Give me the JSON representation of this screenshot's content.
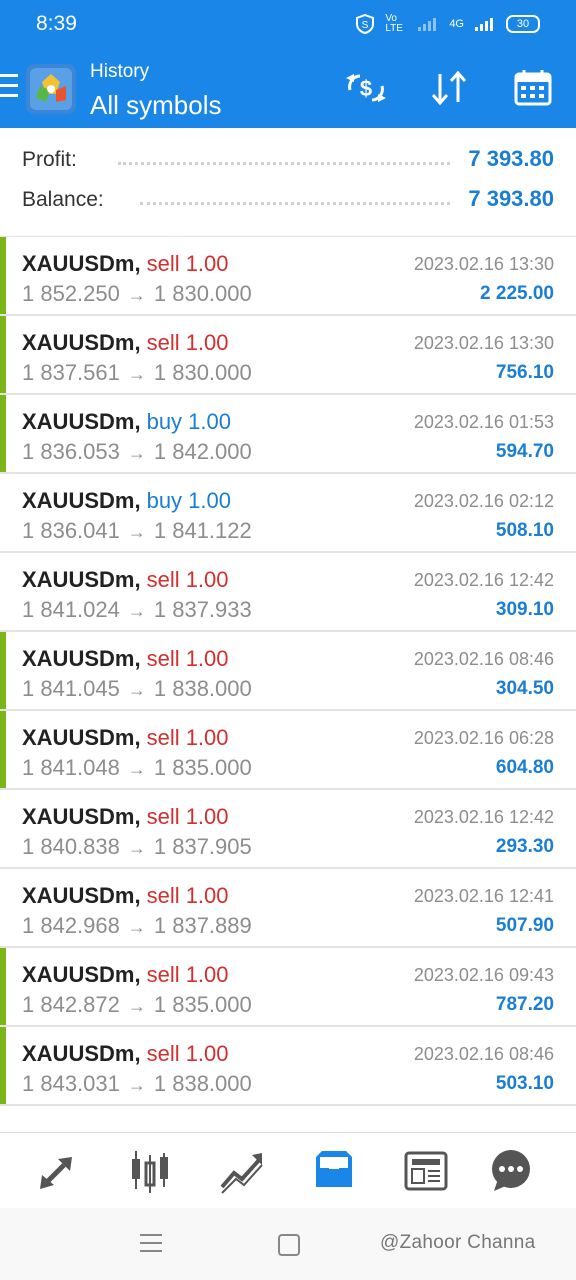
{
  "status_bar": {
    "time": "8:39",
    "network_label": "Vo LTE",
    "signal_label": "4G",
    "battery": "30"
  },
  "header": {
    "title_small": "History",
    "title_big": "All symbols",
    "icons": [
      "menu-icon",
      "app-logo",
      "deposit-icon",
      "sort-icon",
      "calendar-icon"
    ],
    "color": "#1a86e8"
  },
  "summary": {
    "profit_label": "Profit:",
    "profit_value": "7 393.80",
    "balance_label": "Balance:",
    "balance_value": "7 393.80",
    "value_color": "#1a7ed4"
  },
  "trades": [
    {
      "symbol": "XAUUSDm,",
      "side": "sell",
      "volume_label": "sell 1.00",
      "open": "1 852.250",
      "close": "1 830.000",
      "time": "2023.02.16 13:30",
      "profit": "2 225.00",
      "marker": true
    },
    {
      "symbol": "XAUUSDm,",
      "side": "sell",
      "volume_label": "sell 1.00",
      "open": "1 837.561",
      "close": "1 830.000",
      "time": "2023.02.16 13:30",
      "profit": "756.10",
      "marker": true
    },
    {
      "symbol": "XAUUSDm,",
      "side": "buy",
      "volume_label": "buy 1.00",
      "open": "1 836.053",
      "close": "1 842.000",
      "time": "2023.02.16 01:53",
      "profit": "594.70",
      "marker": true
    },
    {
      "symbol": "XAUUSDm,",
      "side": "buy",
      "volume_label": "buy 1.00",
      "open": "1 836.041",
      "close": "1 841.122",
      "time": "2023.02.16 02:12",
      "profit": "508.10",
      "marker": false
    },
    {
      "symbol": "XAUUSDm,",
      "side": "sell",
      "volume_label": "sell 1.00",
      "open": "1 841.024",
      "close": "1 837.933",
      "time": "2023.02.16 12:42",
      "profit": "309.10",
      "marker": false
    },
    {
      "symbol": "XAUUSDm,",
      "side": "sell",
      "volume_label": "sell 1.00",
      "open": "1 841.045",
      "close": "1 838.000",
      "time": "2023.02.16 08:46",
      "profit": "304.50",
      "marker": true
    },
    {
      "symbol": "XAUUSDm,",
      "side": "sell",
      "volume_label": "sell 1.00",
      "open": "1 841.048",
      "close": "1 835.000",
      "time": "2023.02.16 06:28",
      "profit": "604.80",
      "marker": true
    },
    {
      "symbol": "XAUUSDm,",
      "side": "sell",
      "volume_label": "sell 1.00",
      "open": "1 840.838",
      "close": "1 837.905",
      "time": "2023.02.16 12:42",
      "profit": "293.30",
      "marker": false
    },
    {
      "symbol": "XAUUSDm,",
      "side": "sell",
      "volume_label": "sell 1.00",
      "open": "1 842.968",
      "close": "1 837.889",
      "time": "2023.02.16 12:41",
      "profit": "507.90",
      "marker": false
    },
    {
      "symbol": "XAUUSDm,",
      "side": "sell",
      "volume_label": "sell 1.00",
      "open": "1 842.872",
      "close": "1 835.000",
      "time": "2023.02.16 09:43",
      "profit": "787.20",
      "marker": true
    },
    {
      "symbol": "XAUUSDm,",
      "side": "sell",
      "volume_label": "sell 1.00",
      "open": "1 843.031",
      "close": "1 838.000",
      "time": "2023.02.16 08:46",
      "profit": "503.10",
      "marker": true
    }
  ],
  "arrow_glyph": "→",
  "bottom_nav": {
    "items": [
      "quotes-icon",
      "chart-icon",
      "trade-icon",
      "history-icon",
      "news-icon",
      "chat-icon"
    ],
    "active": "history-icon",
    "active_color": "#1a86e8",
    "inactive_color": "#555555"
  },
  "watermark": "@Zahoor Channa",
  "colors": {
    "sell": "#d32f2f",
    "buy": "#1a7ed4",
    "marker": "#7cb518"
  }
}
